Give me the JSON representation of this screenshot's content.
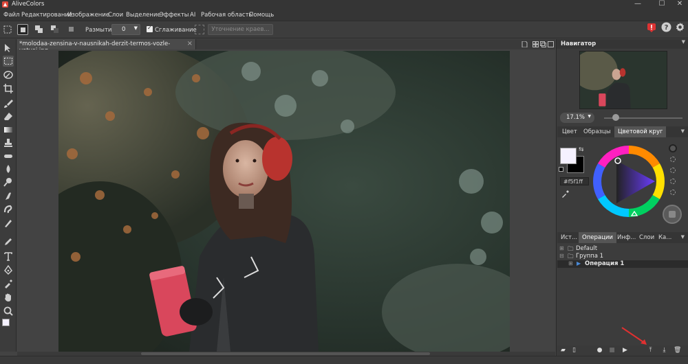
{
  "app": {
    "title": "AliveColors",
    "window_controls": {
      "minimize": "—",
      "maximize": "☐",
      "close": "✕"
    }
  },
  "menu": {
    "items": [
      "Файл",
      "Редактирование",
      "Изображение",
      "Слои",
      "Выделение",
      "Эффекты",
      "AI",
      "Рабочая область",
      "Помощь"
    ]
  },
  "options_bar": {
    "blur_label": "Размытие",
    "blur_value": "0",
    "smoothing_label": "Сглаживание",
    "smoothing_checked": true,
    "refine_button": "Уточнение краев..."
  },
  "document": {
    "tab_name": "*molodaa-zensina-v-nausnikah-derzit-termos-vozle-vetvei.jpg",
    "tab_close": "×"
  },
  "navigator": {
    "title": "Навигатор",
    "zoom": "17.1%"
  },
  "color_panel": {
    "tabs": [
      "Цвет",
      "Образцы",
      "Цветовой круг"
    ],
    "active_tab": "Цветовой круг",
    "foreground": "#f5f1ff",
    "background": "#000000",
    "hex": "#f5f1ff"
  },
  "operations_panel": {
    "tabs": [
      "Ист...",
      "Операции",
      "Инф...",
      "Слои",
      "Ка..."
    ],
    "active_tab": "Операции",
    "tree": [
      {
        "label": "Default",
        "type": "folder"
      },
      {
        "label": "Группа 1",
        "type": "folder"
      },
      {
        "label": "Операция 1",
        "type": "operation",
        "selected": true
      }
    ]
  },
  "colors": {
    "app_bg": "#434343",
    "panel_bg": "#3c3c3c",
    "accent_red": "#e03030"
  }
}
